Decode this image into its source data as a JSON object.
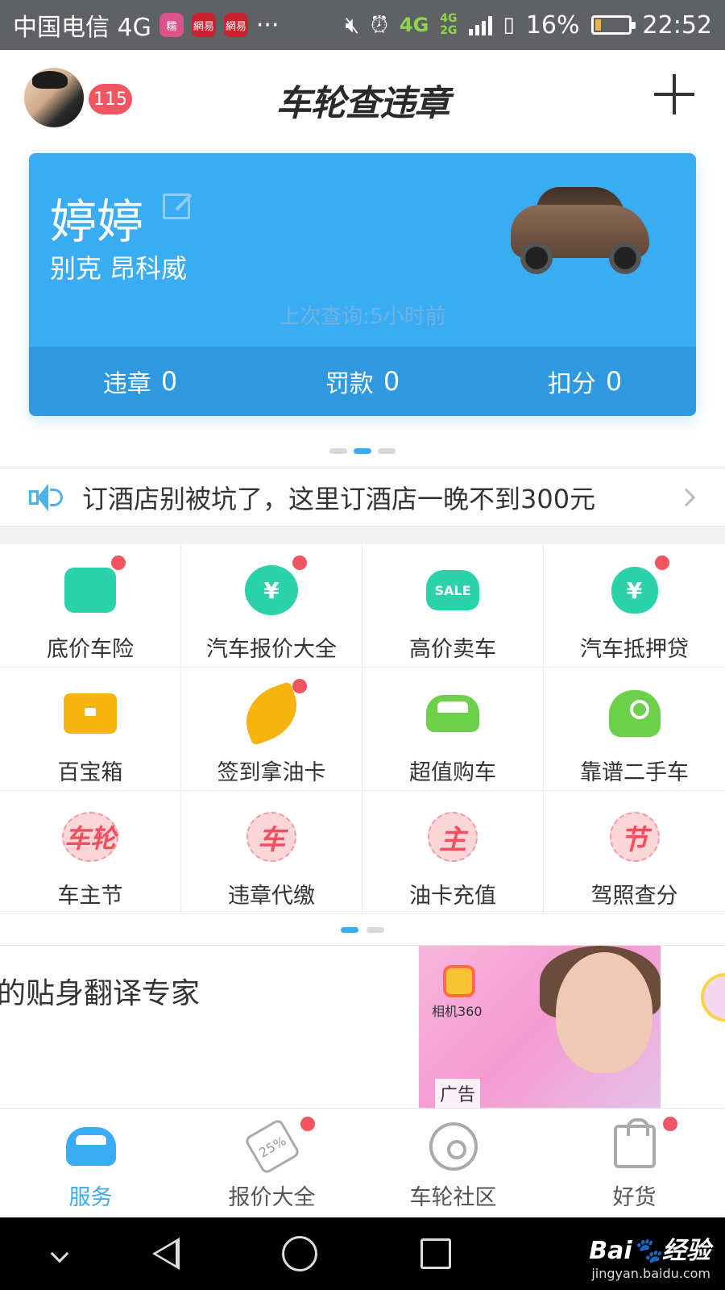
{
  "status_bar": {
    "carrier": "中国电信 4G",
    "app_icons": [
      "糯",
      "網易",
      "網易"
    ],
    "more": "···",
    "network_top": "4G",
    "network_bottom": "2G",
    "network_main": "4G",
    "battery_percent": "16%",
    "battery_level": 0.16,
    "time": "22:52"
  },
  "header": {
    "notification_count": "115",
    "brand_title": "车轮查违章"
  },
  "car_card": {
    "name": "婷婷",
    "model": "别克  昂科威",
    "last_query": "上次查询:5小时前",
    "stats": [
      {
        "label": "违章",
        "value": "0"
      },
      {
        "label": "罚款",
        "value": "0"
      },
      {
        "label": "扣分",
        "value": "0"
      }
    ],
    "background_color": "#3aacf4"
  },
  "notice": {
    "text": "订酒店别被坑了，这里订酒店一晚不到300元"
  },
  "services": [
    {
      "label": "底价车险",
      "icon": "insurance-icon",
      "dot": true
    },
    {
      "label": "汽车报价大全",
      "icon": "price-bubble-icon",
      "dot": true
    },
    {
      "label": "高价卖车",
      "icon": "sale-car-icon",
      "icon_text": "SALE",
      "dot": false
    },
    {
      "label": "汽车抵押贷",
      "icon": "money-bag-icon",
      "dot": true
    },
    {
      "label": "百宝箱",
      "icon": "treasure-box-icon",
      "dot": false
    },
    {
      "label": "签到拿油卡",
      "icon": "feather-sign-icon",
      "dot": true
    },
    {
      "label": "超值购车",
      "icon": "green-car-icon",
      "dot": false
    },
    {
      "label": "靠谱二手车",
      "icon": "green-key-car-icon",
      "dot": false
    },
    {
      "label": "车主节",
      "icon": "stamp-che-lun-icon",
      "icon_text": "车轮",
      "dot": false
    },
    {
      "label": "违章代缴",
      "icon": "stamp-che-icon",
      "icon_text": "车",
      "dot": false
    },
    {
      "label": "油卡充值",
      "icon": "stamp-zhu-icon",
      "icon_text": "主",
      "dot": false
    },
    {
      "label": "驾照查分",
      "icon": "stamp-jie-icon",
      "icon_text": "节",
      "dot": false
    }
  ],
  "ad": {
    "text": "的贴身翻译专家",
    "camera_label": "相机360",
    "badge": "广告"
  },
  "tabs": [
    {
      "label": "服务",
      "icon": "car-icon",
      "active": true,
      "dot": false
    },
    {
      "label": "报价大全",
      "icon": "price-tag-icon",
      "active": false,
      "dot": true,
      "icon_text": "25%"
    },
    {
      "label": "车轮社区",
      "icon": "steering-wheel-icon",
      "active": false,
      "dot": false
    },
    {
      "label": "好货",
      "icon": "shopping-bag-icon",
      "active": false,
      "dot": true
    }
  ],
  "watermark": {
    "main": "Bai🐾经验",
    "sub": "jingyan.baidu.com"
  }
}
